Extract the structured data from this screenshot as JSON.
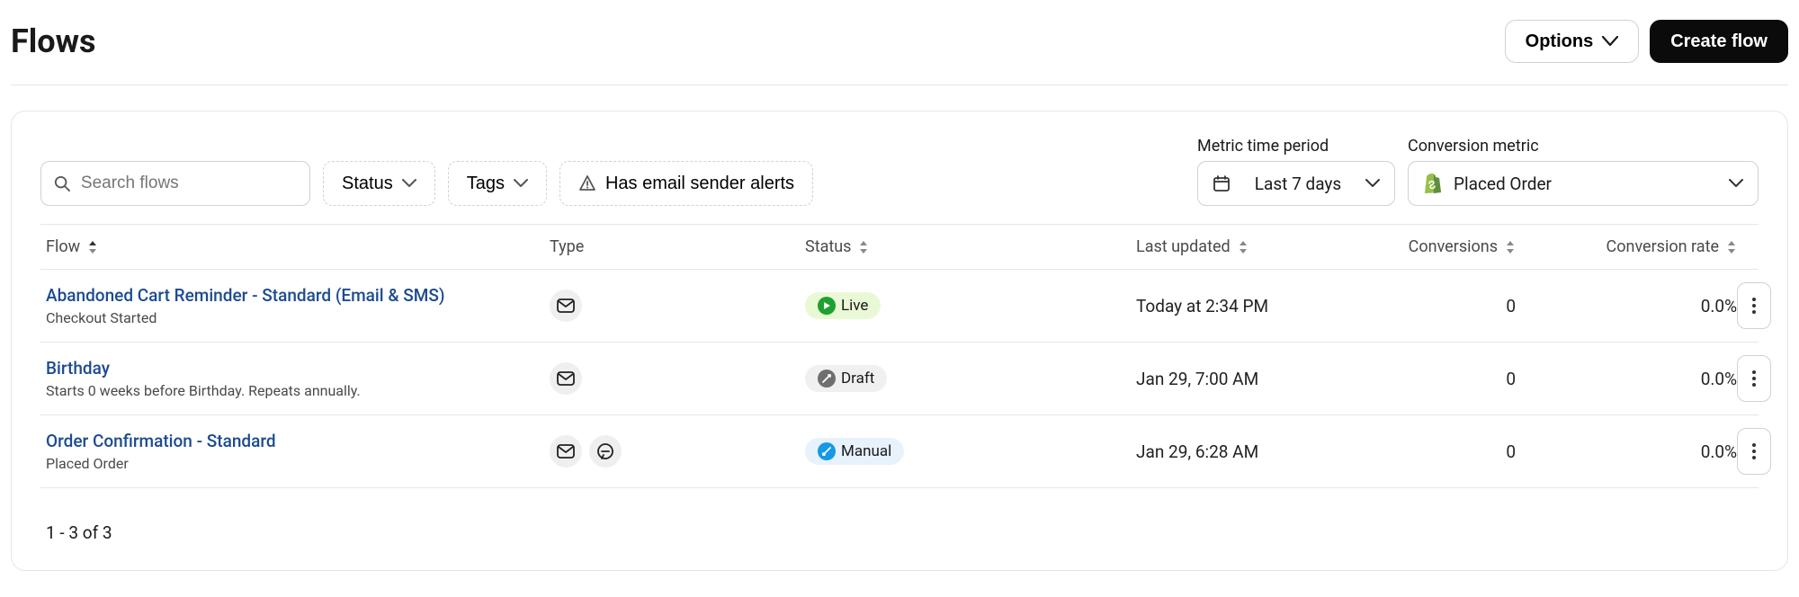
{
  "header": {
    "title": "Flows",
    "options_label": "Options",
    "create_label": "Create flow"
  },
  "filters": {
    "search_placeholder": "Search flows",
    "status_label": "Status",
    "tags_label": "Tags",
    "alerts_label": "Has email sender alerts",
    "metric_period_label": "Metric time period",
    "metric_period_value": "Last 7 days",
    "conversion_metric_label": "Conversion metric",
    "conversion_metric_value": "Placed Order"
  },
  "columns": {
    "flow": "Flow",
    "type": "Type",
    "status": "Status",
    "updated": "Last updated",
    "conversions": "Conversions",
    "rate": "Conversion rate"
  },
  "rows": [
    {
      "name": "Abandoned Cart Reminder - Standard (Email & SMS)",
      "sub": "Checkout Started",
      "types": [
        "email"
      ],
      "status": {
        "kind": "live",
        "label": "Live"
      },
      "updated": "Today at 2:34 PM",
      "conversions": "0",
      "rate": "0.0%"
    },
    {
      "name": "Birthday",
      "sub": "Starts 0 weeks before Birthday. Repeats annually.",
      "types": [
        "email"
      ],
      "status": {
        "kind": "draft",
        "label": "Draft"
      },
      "updated": "Jan 29, 7:00 AM",
      "conversions": "0",
      "rate": "0.0%"
    },
    {
      "name": "Order Confirmation - Standard",
      "sub": "Placed Order",
      "types": [
        "email",
        "sms"
      ],
      "status": {
        "kind": "manual",
        "label": "Manual"
      },
      "updated": "Jan 29, 6:28 AM",
      "conversions": "0",
      "rate": "0.0%"
    }
  ],
  "pagination": "1 - 3 of 3"
}
